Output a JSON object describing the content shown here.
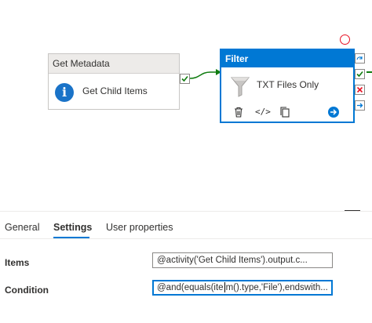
{
  "canvas": {
    "activities": [
      {
        "type_label": "Get Metadata",
        "name": "Get Child Items",
        "icon": "info-icon"
      },
      {
        "type_label": "Filter",
        "name": "TXT Files Only",
        "icon": "funnel-icon"
      }
    ],
    "filter_tools": [
      "delete-icon",
      "code-icon",
      "copy-icon",
      "go-to-icon"
    ],
    "side_icons": [
      "skip-icon",
      "success-icon",
      "failure-icon",
      "completion-icon"
    ],
    "colors": {
      "accent": "#0078d4",
      "success": "#107c10",
      "failure": "#e81123"
    }
  },
  "tabs": [
    "General",
    "Settings",
    "User properties"
  ],
  "active_tab": "Settings",
  "settings": {
    "items_label": "Items",
    "items_value": "@activity('Get Child Items').output.c...",
    "condition_label": "Condition",
    "condition_value_before_caret": "@and(equals(ite",
    "condition_value_after_caret": "m().type,'File'),endswith..."
  }
}
